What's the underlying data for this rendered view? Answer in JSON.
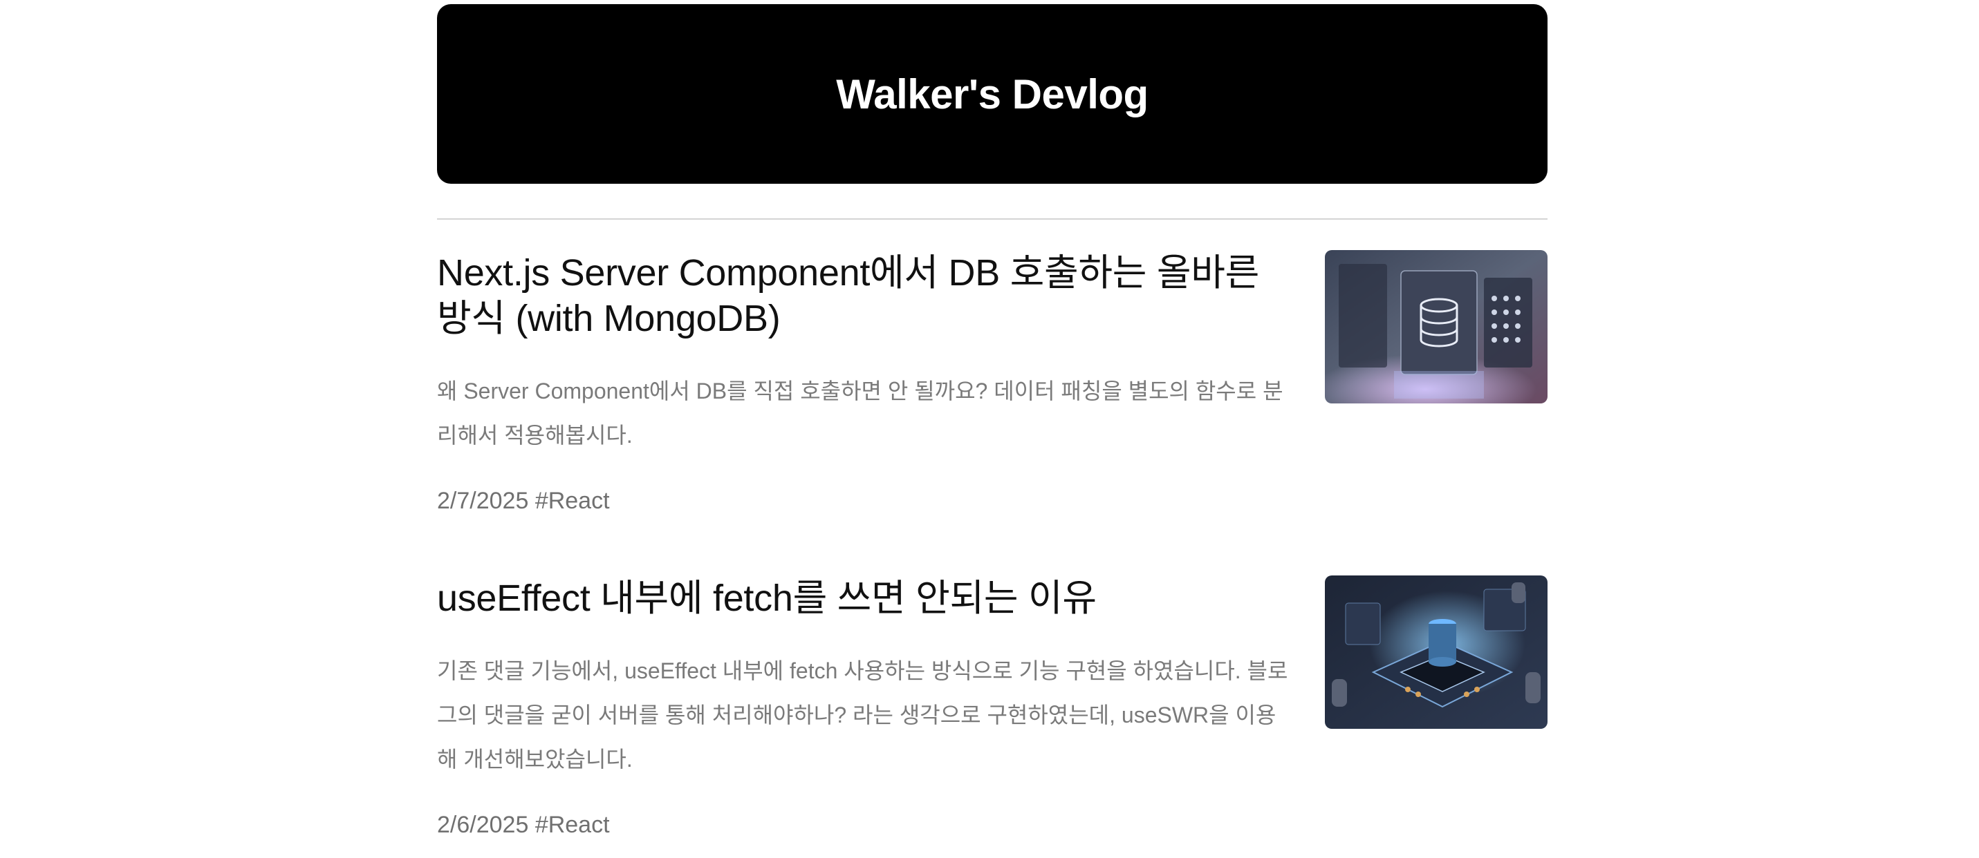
{
  "site": {
    "title": "Walker's Devlog"
  },
  "posts": [
    {
      "title": "Next.js Server Component에서 DB 호출하는 올바른 방식 (with MongoDB)",
      "description": "왜 Server Component에서 DB를 직접 호출하면 안 될까요? 데이터 패칭을 별도의 함수로 분리해서 적용해봅시다.",
      "date": "2/7/2025",
      "tag": "#React",
      "thumbnail_icon": "database-server-illustration-icon"
    },
    {
      "title": "useEffect 내부에 fetch를 쓰면 안되는 이유",
      "description": "기존 댓글 기능에서, useEffect 내부에 fetch 사용하는 방식으로 기능 구현을 하였습니다. 블로그의 댓글을 굳이 서버를 통해 처리해야하나? 라는 생각으로 구현하였는데, useSWR을 이용해 개선해보았습니다.",
      "date": "2/6/2025",
      "tag": "#React",
      "thumbnail_icon": "useswr-chip-illustration-icon"
    }
  ],
  "colors": {
    "header_bg": "#000000",
    "header_text": "#ffffff",
    "muted_text": "#7a7a7a",
    "divider": "#d4d4d4"
  }
}
